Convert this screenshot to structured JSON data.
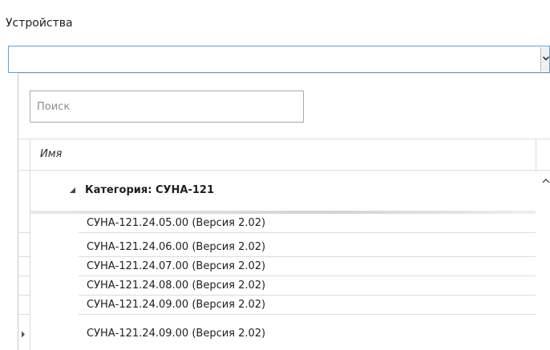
{
  "field": {
    "label": "Устройства",
    "value": ""
  },
  "search": {
    "placeholder": "Поиск"
  },
  "grid": {
    "column_header": "Имя",
    "group": {
      "label": "Категория: СУНА-121",
      "expanded": true
    },
    "rows": [
      "СУНА-121.24.05.00 (Версия 2.02)",
      "СУНА-121.24.06.00 (Версия 2.02)",
      "СУНА-121.24.07.00 (Версия 2.02)",
      "СУНА-121.24.08.00 (Версия 2.02)",
      "СУНА-121.24.09.00 (Версия 2.02)"
    ],
    "current_row_index": 4
  },
  "colors": {
    "focus_border": "#5aa0d8",
    "grid_line": "#dcdcdc"
  },
  "icons": [
    "chevron-down-icon",
    "expand-triangle-icon",
    "scroll-up-icon",
    "current-row-arrow-icon"
  ]
}
